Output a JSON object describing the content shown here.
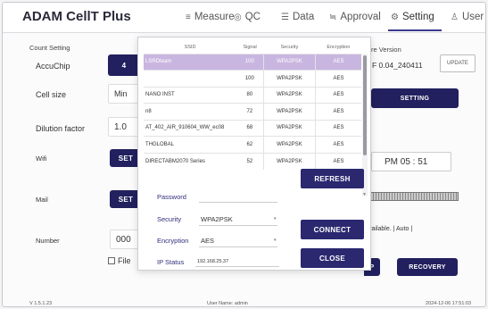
{
  "app": {
    "title": "ADAM CellT Plus"
  },
  "nav": [
    {
      "label": "Measure",
      "icon": "measure-icon",
      "glyph": "≡"
    },
    {
      "label": "QC",
      "icon": "shield-icon",
      "glyph": "◎"
    },
    {
      "label": "Data",
      "icon": "list-icon",
      "glyph": "☰"
    },
    {
      "label": "Approval",
      "icon": "approval-icon",
      "glyph": "≒"
    },
    {
      "label": "Setting",
      "icon": "gear-icon",
      "glyph": "⚙"
    },
    {
      "label": "User",
      "icon": "user-icon",
      "glyph": "♙"
    }
  ],
  "background": {
    "count_setting": "Count Setting",
    "accuchip": "AccuChip",
    "accuchip_value": "4",
    "cell_size": "Cell size",
    "cell_size_value": "Min",
    "dilution": "Dilution factor",
    "dilution_value": "1.0",
    "wifi": "Wifi",
    "wifi_button": "SET",
    "mail": "Mail",
    "mail_button": "SET",
    "number": "Number",
    "number_value": "000",
    "file_label": "File",
    "software_version_label": "re Version",
    "software_version": "F 0.04_240411",
    "update": "UPDATE",
    "setting": "SETTING",
    "time": "PM  05 : 51",
    "available_text": "vailable. | Auto |",
    "p_button": "P",
    "recovery": "RECOVERY",
    "version": "V 1.5.1.23",
    "user_name": "User Name: admin",
    "datetime": "2024-12-06 17:51:03"
  },
  "modal": {
    "columns": [
      "SSID",
      "Signal",
      "Security",
      "Encryption"
    ],
    "networks": [
      {
        "ssid": "LSRDteam",
        "signal": "100",
        "security": "WPA2PSK",
        "encryption": "AES",
        "selected": true
      },
      {
        "ssid": "",
        "signal": "100",
        "security": "WPA2PSK",
        "encryption": "AES",
        "selected": false
      },
      {
        "ssid": "NANO INST",
        "signal": "80",
        "security": "WPA2PSK",
        "encryption": "AES",
        "selected": false
      },
      {
        "ssid": "n8",
        "signal": "72",
        "security": "WPA2PSK",
        "encryption": "AES",
        "selected": false
      },
      {
        "ssid": "AT_402_AIR_910604_WW_ec08",
        "signal": "68",
        "security": "WPA2PSK",
        "encryption": "AES",
        "selected": false
      },
      {
        "ssid": "THGLOBAL",
        "signal": "62",
        "security": "WPA2PSK",
        "encryption": "AES",
        "selected": false
      },
      {
        "ssid": "DIRECTABM2070 Series",
        "signal": "52",
        "security": "WPA2PSK",
        "encryption": "AES",
        "selected": false
      }
    ],
    "refresh": "REFRESH",
    "password_label": "Password",
    "password_value": "",
    "security_label": "Security",
    "security_value": "WPA2PSK",
    "encryption_label": "Encryption",
    "encryption_value": "AES",
    "ip_label": "IP Status",
    "ip_value": "192.168.25.37",
    "connect": "CONNECT",
    "close": "CLOSE"
  }
}
